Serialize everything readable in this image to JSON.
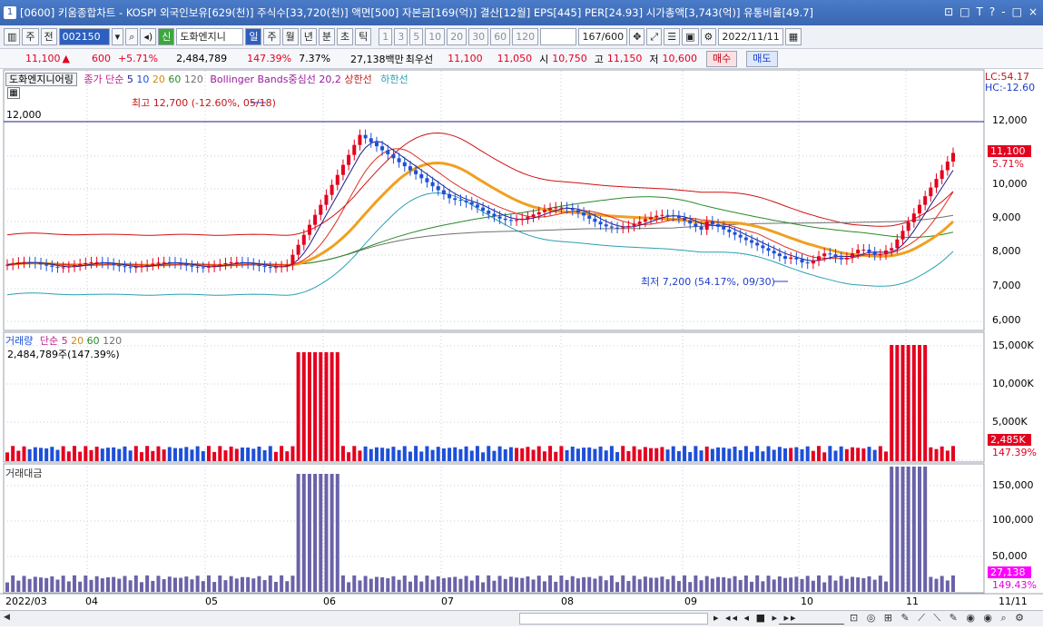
{
  "title": {
    "code_badge": "1",
    "text": "[0600] 키움종합차트 - KOSPI 외국인보유[629(천)] 주식수[33,720(천)] 액면[500] 자본금[169(억)] 결산[12월] EPS[445] PER[24.93] 시가총액[3,743(억)] 유통비율[49.7]",
    "controls": [
      "⊡",
      "□",
      "T",
      "?",
      "-",
      "□",
      "×"
    ]
  },
  "toolbar": {
    "period_label": "주",
    "prev_label": "전",
    "stock_code": "002150",
    "stock_name": "도화엔지니",
    "new_badge": "신",
    "periods": [
      "일",
      "주",
      "월",
      "년",
      "분",
      "초",
      "틱"
    ],
    "active_period": "일",
    "intervals": [
      "1",
      "3",
      "5",
      "10",
      "20",
      "30",
      "60",
      "120"
    ],
    "count": "167/600",
    "date": "2022/11/11"
  },
  "quote": {
    "price": "11,100",
    "change_arrow": "▲",
    "change": "600",
    "change_pct": "+5.71%",
    "volume": "2,484,789",
    "volume_ratio": "147.39%",
    "turnover": "7.37%",
    "amount": "27,138백만",
    "best_ask_label": "최우선",
    "best_ask": "11,100",
    "best_bid": "11,050",
    "open_label": "시",
    "open": "10,750",
    "high_label": "고",
    "high": "11,150",
    "low_label": "저",
    "low": "10,600",
    "buy_label": "매수",
    "sell_label": "매도"
  },
  "price_panel": {
    "stock_tag": "도화엔지니어링",
    "ma_label": "종가 단순",
    "ma_periods": [
      "5",
      "10",
      "20",
      "60",
      "120"
    ],
    "bb_label": "Bollinger Bands중심선 20,2",
    "bb_upper": "상한선",
    "bb_lower": "하한선",
    "lc": "LC:54.17",
    "hc": "HC:-12.60",
    "ref_line": "12,000",
    "high_annot": "최고 12,700 (-12.60%, 05/18)",
    "low_annot": "최저 7,200 (54.17%, 09/30)",
    "price_tag": "11,100",
    "price_tag_pct": "5.71%",
    "y_ticks": [
      "12,000",
      "11,000",
      "10,000",
      "9,000",
      "8,000",
      "7,000",
      "6,000"
    ]
  },
  "volume_panel": {
    "label": "거래량",
    "ma_label": "단순",
    "ma_periods": [
      "5",
      "20",
      "60",
      "120"
    ],
    "value": "2,484,789주(147.39%)",
    "y_ticks": [
      "15,000K",
      "10,000K",
      "5,000K"
    ],
    "tag": "2,485K",
    "tag_pct": "147.39%"
  },
  "amount_panel": {
    "label": "거래대금",
    "y_ticks": [
      "150,000",
      "100,000",
      "50,000"
    ],
    "tag": "27,138",
    "tag_pct": "149.43%"
  },
  "x_axis": {
    "labels": [
      "2022/03",
      "04",
      "05",
      "06",
      "07",
      "08",
      "09",
      "10",
      "11"
    ],
    "end_label": "11/11"
  },
  "colors": {
    "up": "#e4001f",
    "down": "#1d4fd8",
    "ma5": "#1c1c8a",
    "ma10": "#e0301e",
    "ma20": "#f0a020",
    "ma60": "#2a8a2a",
    "ma120": "#707070",
    "bb_upper": "#d01010",
    "bb_lower": "#28a0b0",
    "amount_bar": "#6a62a8"
  }
}
